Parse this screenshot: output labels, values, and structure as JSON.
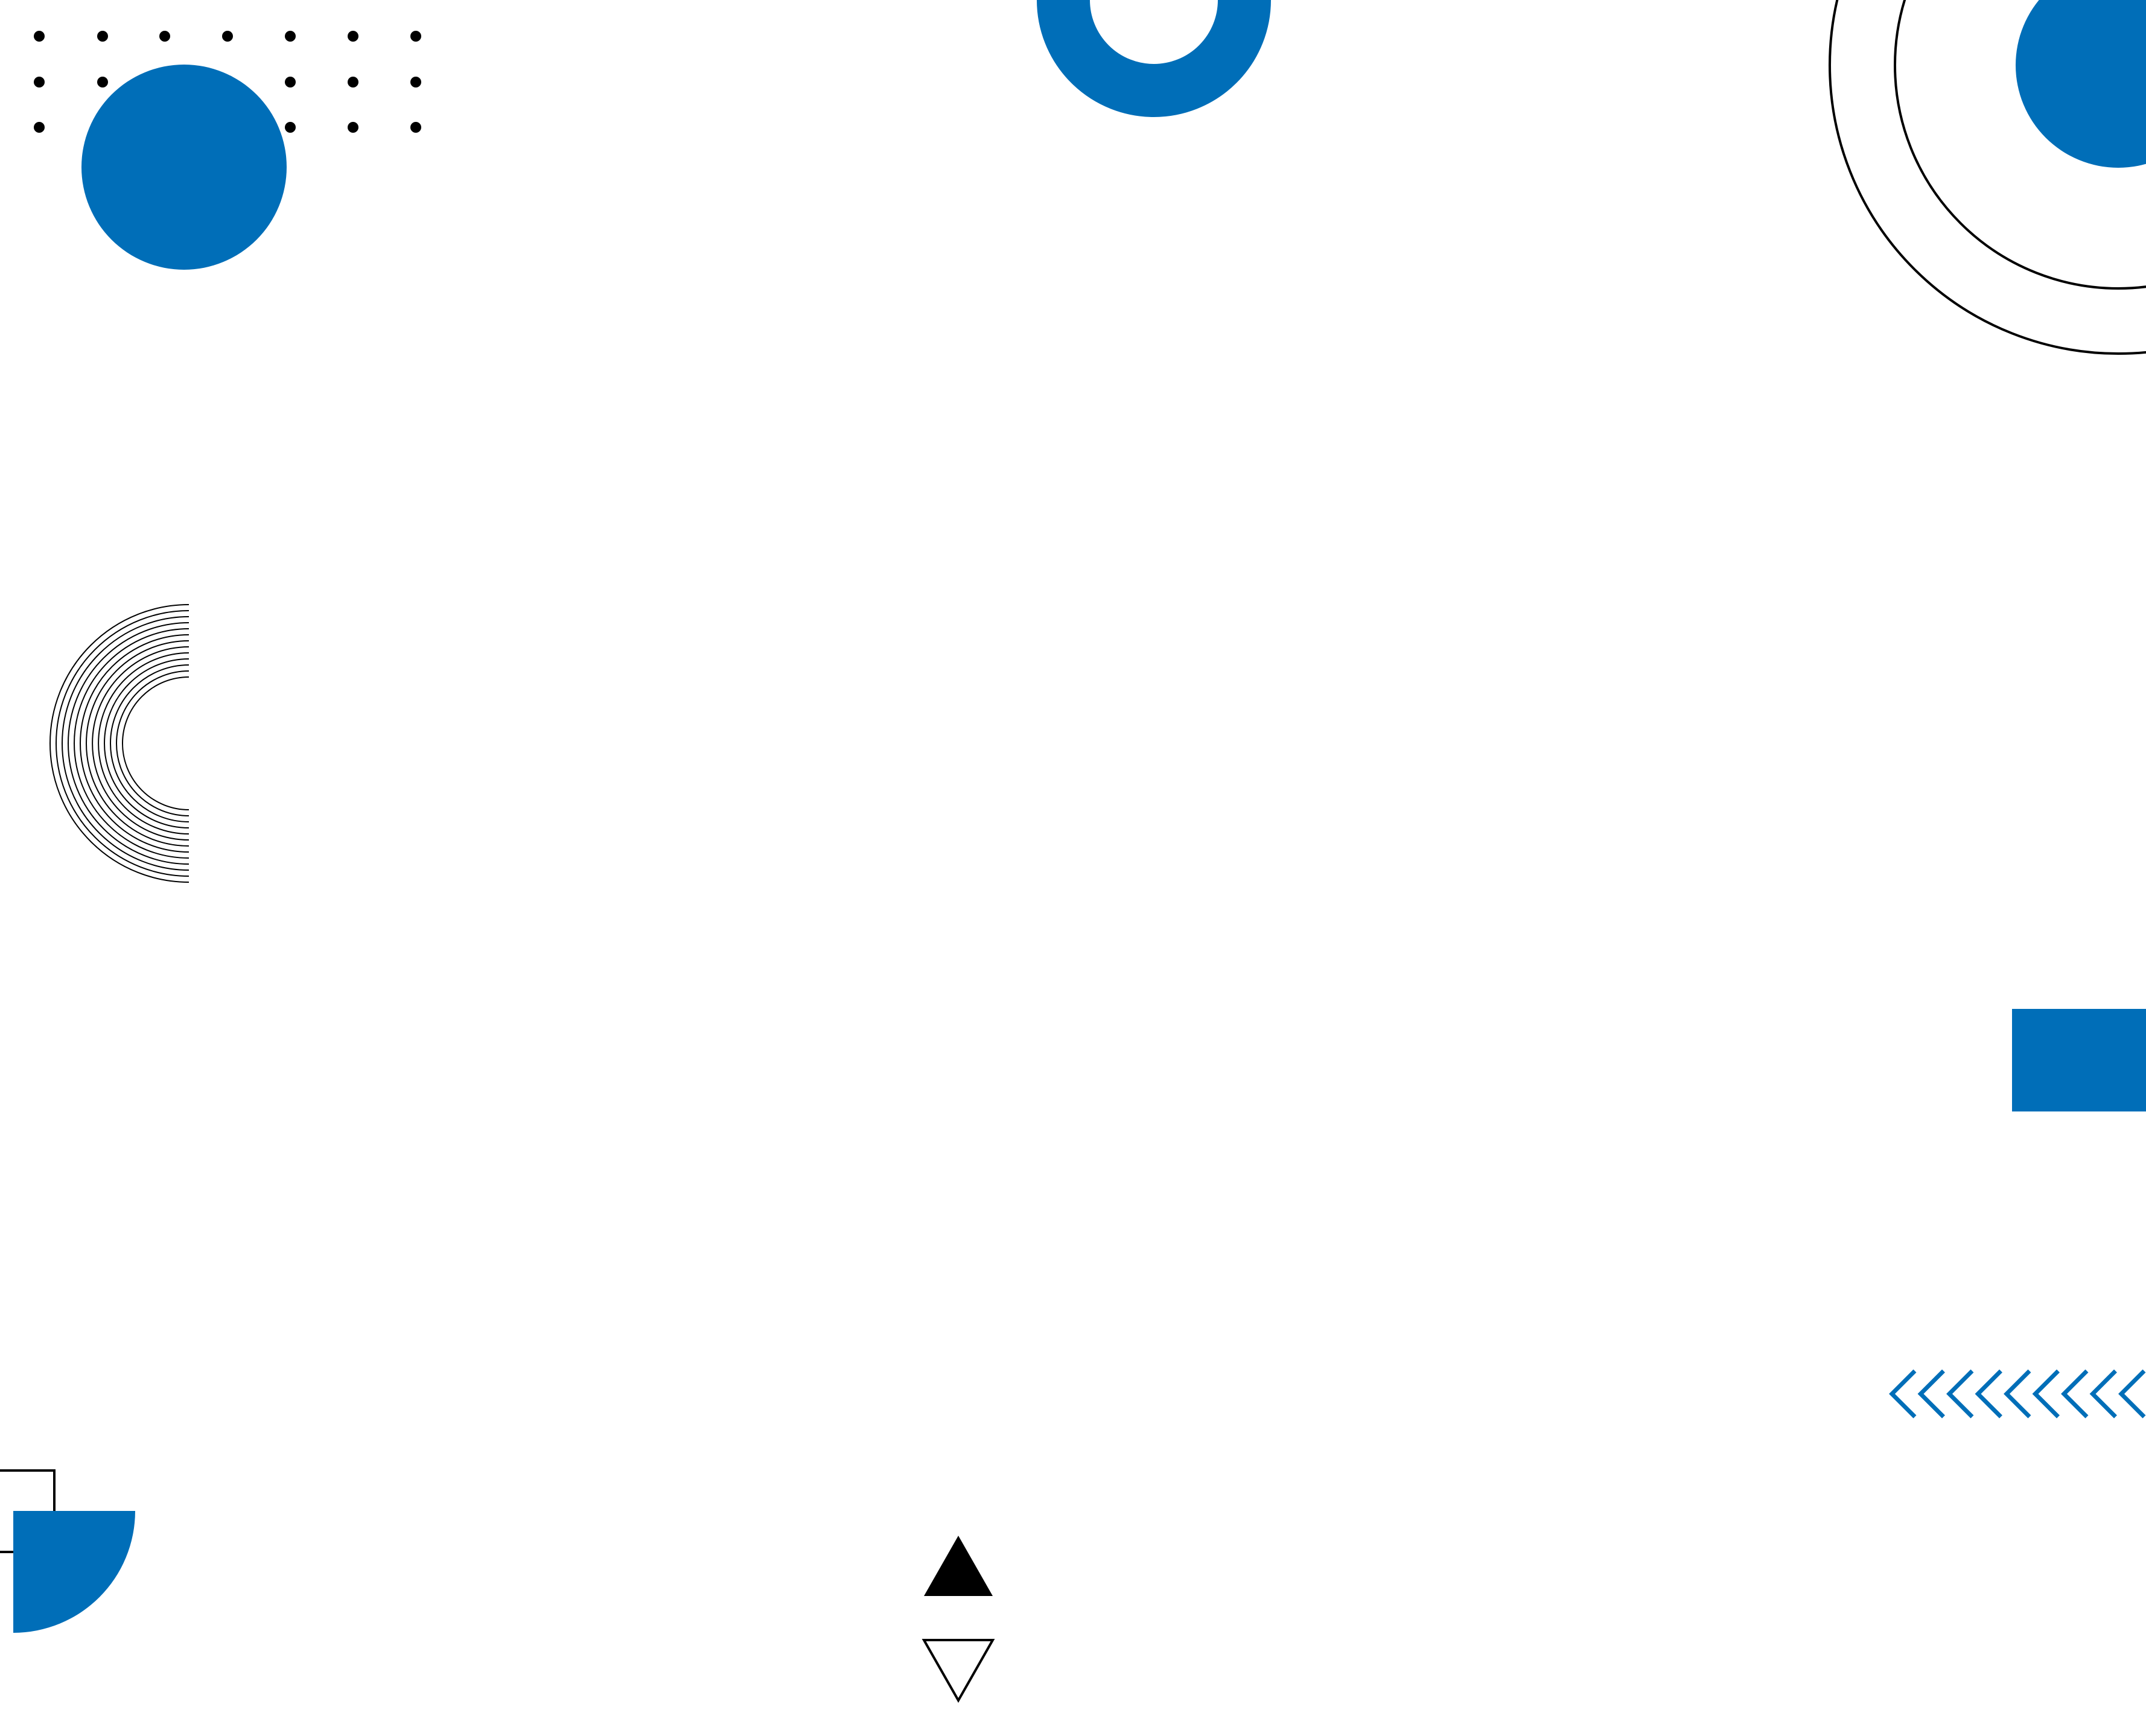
{
  "colors": {
    "background": "#ffffff",
    "accent": "#006EB8",
    "stroke": "#000000"
  },
  "shapes": [
    "dot-grid",
    "filled-circle",
    "ring",
    "concentric-arcs",
    "partial-circle",
    "line-arc-stack",
    "blue-rectangle",
    "chevron-row",
    "square-outline",
    "quarter-circle",
    "triangle-filled",
    "triangle-outline"
  ]
}
